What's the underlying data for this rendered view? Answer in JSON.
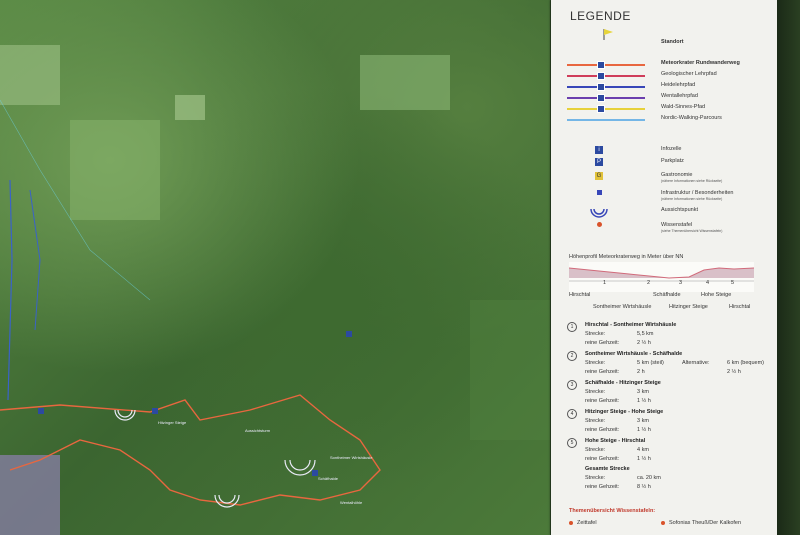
{
  "map": {
    "labels": [
      "Hitzinger Steige",
      "Schäfhalde",
      "Aussichtsturm",
      "Sontheimer Wirtshäusle",
      "Wentalhöhle"
    ],
    "colors": {
      "route": "#e8673f",
      "trail_blue": "#3a63c8",
      "water": "#6bd3e8"
    }
  },
  "legend": {
    "title": "LEGENDE",
    "standort": "Standort",
    "lines": [
      {
        "label": "Meteorkrater Rundwanderweg",
        "color": "#e8673f",
        "bold": true
      },
      {
        "label": "Geologischer Lehrpfad",
        "color": "#cf3d5a",
        "bold": false
      },
      {
        "label": "Heidelehrpfad",
        "color": "#3847b8",
        "bold": false
      },
      {
        "label": "Wentallehrpfad",
        "color": "#6b3fae",
        "bold": false
      },
      {
        "label": "Wald-Sinnes-Pfad",
        "color": "#e7d13a",
        "bold": false
      },
      {
        "label": "Nordic-Walking-Parcours",
        "color": "#74b6e6",
        "bold": false
      }
    ],
    "symbols": [
      {
        "icon": "info-icon",
        "glyph": "i",
        "label": "Infozelle",
        "sub": ""
      },
      {
        "icon": "parking-icon",
        "glyph": "P",
        "label": "Parkplatz",
        "sub": ""
      },
      {
        "icon": "gastronomy-icon",
        "glyph": "G",
        "label": "Gastronomie",
        "sub": "(nähere Informationen siehe Rückseite)"
      },
      {
        "icon": "infrastructure-icon",
        "glyph": "",
        "label": "Infrastruktur / Besonderheiten",
        "sub": "(nähere Informationen siehe Rückseite)"
      },
      {
        "icon": "viewpoint-icon",
        "glyph": "",
        "label": "Aussichtspunkt",
        "sub": ""
      },
      {
        "icon": "info-board-icon",
        "glyph": "",
        "label": "Wissenstafel",
        "sub": "(siehe Themenübersicht Wissenstafeln)"
      }
    ]
  },
  "profile": {
    "title": "Höhenprofil Meteorkraterweg in Meter über NN",
    "top_labels": [
      "Hirschtal",
      "Schäfhalde",
      "Hohe Steige"
    ],
    "bottom_labels": [
      "Sontheimer Wirtshäusle",
      "Hitzinger Steige",
      "Hirschtal"
    ],
    "markers": [
      "1",
      "2",
      "3",
      "4",
      "5"
    ]
  },
  "segments": [
    {
      "num": "1",
      "title": "Hirschtal - Sontheimer Wirtshäusle",
      "lines": [
        [
          "Strecke:",
          "5,5 km"
        ],
        [
          "reine Gehzeit:",
          "2 ½ h"
        ]
      ],
      "alt": []
    },
    {
      "num": "2",
      "title": "Sontheimer Wirtshäusle - Schäfhalde",
      "lines": [
        [
          "Strecke:",
          "5 km (steil)"
        ],
        [
          "reine Gehzeit:",
          "2 h"
        ]
      ],
      "alt": [
        "Alternative:",
        "6 km (bequem)",
        "2 ½ h"
      ]
    },
    {
      "num": "3",
      "title": "Schäfhalde - Hitzinger Steige",
      "lines": [
        [
          "Strecke:",
          "3 km"
        ],
        [
          "reine Gehzeit:",
          "1 ½ h"
        ]
      ],
      "alt": []
    },
    {
      "num": "4",
      "title": "Hitzinger Steige - Hohe Steige",
      "lines": [
        [
          "Strecke:",
          "3 km"
        ],
        [
          "reine Gehzeit:",
          "1 ½ h"
        ]
      ],
      "alt": []
    },
    {
      "num": "5",
      "title": "Hohe Steige - Hirschtal",
      "lines": [
        [
          "Strecke:",
          "4 km"
        ],
        [
          "reine Gehzeit:",
          "1 ½ h"
        ]
      ],
      "alt": []
    }
  ],
  "total": {
    "title": "Gesamte Strecke",
    "lines": [
      [
        "Strecke:",
        "ca. 20 km"
      ],
      [
        "reine Gehzeit:",
        "8 ½ h"
      ]
    ]
  },
  "themes": {
    "title": "Themenübersicht Wissenstafeln:",
    "items": [
      "Zeittafel",
      "Sofonias Theuß/Der Kalkofen"
    ]
  }
}
